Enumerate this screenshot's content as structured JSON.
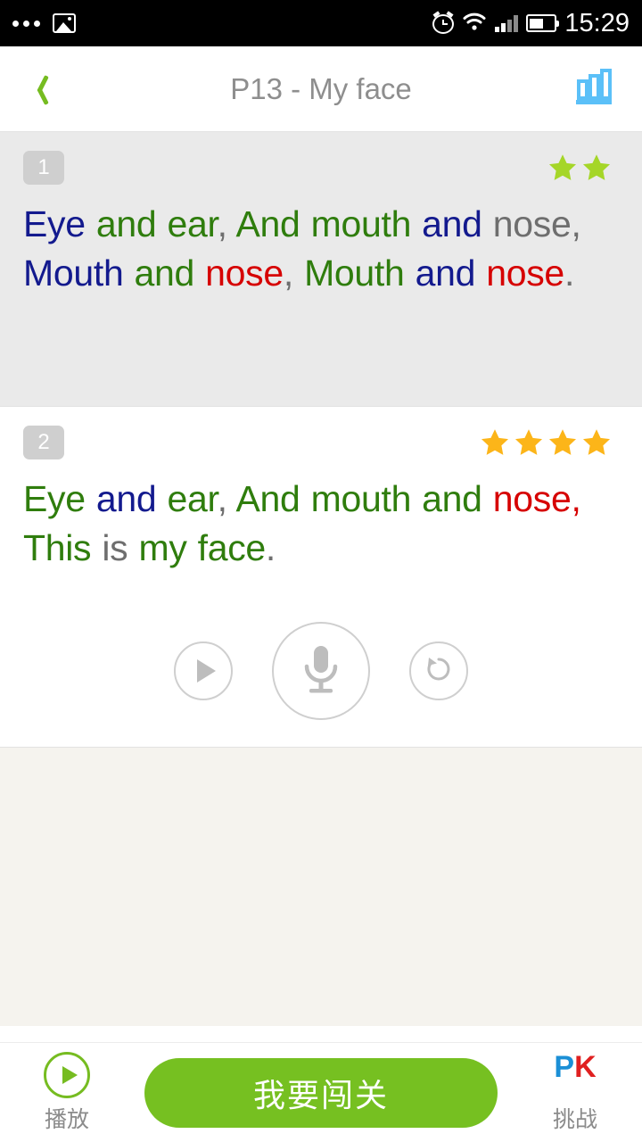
{
  "status_bar": {
    "time": "15:29",
    "left_icons": [
      "more-dots-icon",
      "photo-icon"
    ],
    "right_icons": [
      "alarm-clock-icon",
      "wifi-icon",
      "signal-bars-icon",
      "battery-icon"
    ]
  },
  "header": {
    "back_icon": "chevron-left-icon",
    "title": "P13 - My face",
    "chart_icon": "bar-chart-icon",
    "back_color": "#76bc21",
    "chart_color": "#5bc0f8",
    "title_color": "#8e8e8e"
  },
  "colors": {
    "navy": "#131a8e",
    "green": "#2f7d0d",
    "red": "#d60000",
    "gray": "#6e6e6e",
    "star_green": "#a5d628",
    "star_gold": "#fcb519",
    "accent_green": "#76c021",
    "card_alt_bg": "#eaeaea",
    "filler_bg": "#f5f3ee"
  },
  "sentences": [
    {
      "index": "1",
      "stars": 2,
      "star_color": "star_green",
      "background": "gray",
      "words": [
        {
          "text": "Eye",
          "color": "navy"
        },
        {
          "text": " and ",
          "color": "green"
        },
        {
          "text": "ear",
          "color": "green"
        },
        {
          "text": ", ",
          "color": "gray"
        },
        {
          "text": "And mouth ",
          "color": "green"
        },
        {
          "text": "and ",
          "color": "navy"
        },
        {
          "text": "nose",
          "color": "gray"
        },
        {
          "text": ", ",
          "color": "gray"
        },
        {
          "text": "Mouth ",
          "color": "navy"
        },
        {
          "text": "and ",
          "color": "green"
        },
        {
          "text": "nose",
          "color": "red"
        },
        {
          "text": ", ",
          "color": "gray"
        },
        {
          "text": "Mouth ",
          "color": "green"
        },
        {
          "text": "and ",
          "color": "navy"
        },
        {
          "text": "nose",
          "color": "red"
        },
        {
          "text": ".",
          "color": "gray"
        }
      ]
    },
    {
      "index": "2",
      "stars": 4,
      "star_color": "star_gold",
      "background": "white",
      "words": [
        {
          "text": "Eye ",
          "color": "green"
        },
        {
          "text": "and ",
          "color": "navy"
        },
        {
          "text": "ear",
          "color": "green"
        },
        {
          "text": ", ",
          "color": "gray"
        },
        {
          "text": "And mouth and ",
          "color": "green"
        },
        {
          "text": "nose",
          "color": "red"
        },
        {
          "text": ", ",
          "color": "red"
        },
        {
          "text": "This ",
          "color": "green"
        },
        {
          "text": "is ",
          "color": "gray"
        },
        {
          "text": "my face",
          "color": "green"
        },
        {
          "text": ".",
          "color": "gray"
        }
      ]
    }
  ],
  "record_controls": [
    {
      "name": "play-button",
      "icon": "play-icon"
    },
    {
      "name": "record-button",
      "icon": "microphone-icon"
    },
    {
      "name": "replay-button",
      "icon": "replay-icon"
    }
  ],
  "bottom_bar": {
    "play": {
      "icon": "play-circle-icon",
      "label": "播放"
    },
    "cta": {
      "label": "我要闯关"
    },
    "pk": {
      "icon": "pk-icon",
      "p": "P",
      "k": "K",
      "label": "挑战"
    }
  }
}
